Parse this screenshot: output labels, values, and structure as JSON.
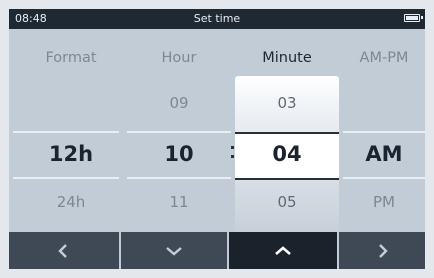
{
  "status_bar": {
    "time": "08:48",
    "title": "Set time",
    "battery_icon": "battery-icon"
  },
  "columns": {
    "format": {
      "header": "Format",
      "values": {
        "above": "",
        "selected": "12h",
        "below": "24h"
      }
    },
    "hour": {
      "header": "Hour",
      "values": {
        "above": "09",
        "selected": "10",
        "below": "11"
      }
    },
    "minute": {
      "header": "Minute",
      "values": {
        "above": "03",
        "selected": "04",
        "below": "05"
      }
    },
    "ampm": {
      "header": "AM-PM",
      "values": {
        "above": "",
        "selected": "AM",
        "below": "PM"
      }
    }
  },
  "active_column": "minute",
  "nav_buttons": [
    {
      "icon": "chevron-left-icon"
    },
    {
      "icon": "chevron-down-icon"
    },
    {
      "icon": "chevron-up-icon",
      "active": true
    },
    {
      "icon": "chevron-right-icon"
    }
  ]
}
